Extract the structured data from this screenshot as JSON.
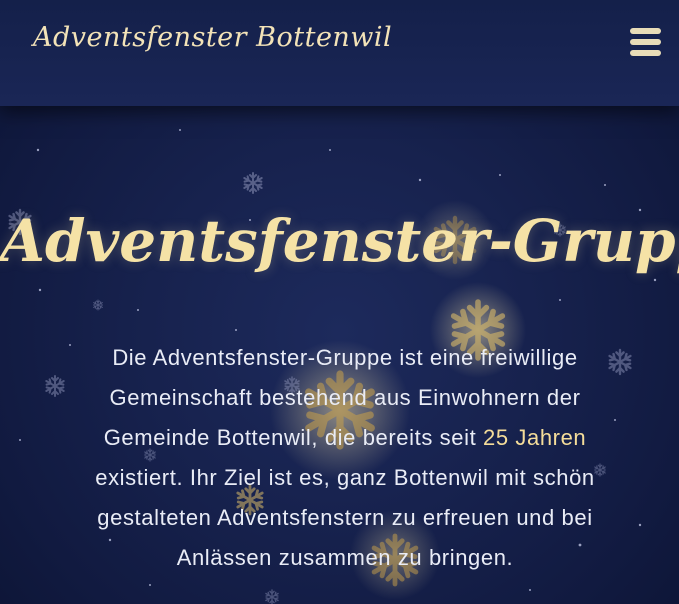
{
  "header": {
    "brand": "Adventsfenster Bottenwil"
  },
  "main": {
    "title": "Adventsfenster-Gruppe",
    "intro_before": "Die Adventsfenster-Gruppe ist eine freiwillige Gemeinschaft bestehend aus Einwohnern der Gemeinde Bottenwil, die bereits seit",
    "intro_highlight": "25 Jahren",
    "intro_after": "existiert. Ihr Ziel ist es, ganz Bottenwil mit schön gestalteten Adventsfenstern zu erfreuen und bei Anlässen zusammen zu bringen."
  },
  "icons": {
    "menu": "hamburger-menu-icon",
    "decor": "snowflake-icon"
  },
  "colors": {
    "background": "#17224e",
    "gold": "#f5e2a6",
    "text": "#e9ecf6"
  }
}
